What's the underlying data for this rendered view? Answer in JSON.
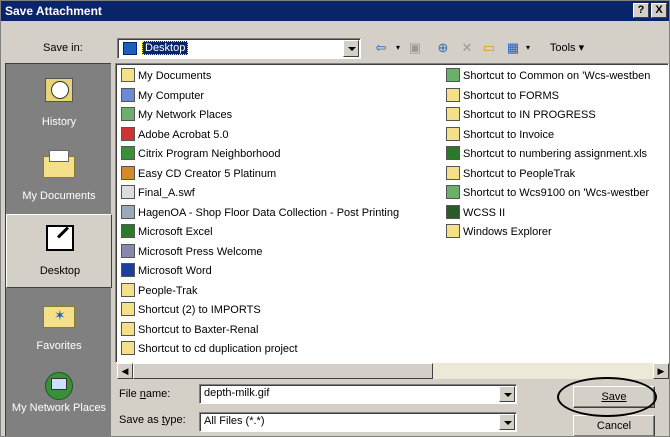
{
  "window": {
    "title": "Save Attachment"
  },
  "titlebar": {
    "help": "?",
    "close": "X"
  },
  "save_in": {
    "label": "Save in:",
    "value": "Desktop"
  },
  "toolbar": {
    "tools_label": "Tools",
    "icons": [
      "back-icon",
      "up-folder-icon",
      "search-web-icon",
      "delete-icon",
      "new-folder-icon",
      "views-icon"
    ]
  },
  "places": [
    {
      "label": "History",
      "icon": "history-icon",
      "active": false
    },
    {
      "label": "My Documents",
      "icon": "my-documents-icon",
      "active": false
    },
    {
      "label": "Desktop",
      "icon": "desktop-icon",
      "active": true
    },
    {
      "label": "Favorites",
      "icon": "favorites-icon",
      "active": false
    },
    {
      "label": "My Network Places",
      "icon": "network-places-icon",
      "active": false
    }
  ],
  "files_col1": [
    "My Documents",
    "My Computer",
    "My Network Places",
    "Adobe Acrobat 5.0",
    "Citrix Program Neighborhood",
    "Easy CD Creator 5 Platinum",
    "Final_A.swf",
    "HagenOA - Shop Floor Data Collection - Post Printing",
    "Microsoft Excel",
    "Microsoft Press Welcome",
    "Microsoft Word",
    "People-Trak",
    "Shortcut (2) to IMPORTS",
    "Shortcut to Baxter-Renal",
    "Shortcut to cd duplication project"
  ],
  "files_col2": [
    "Shortcut to Common on 'Wcs-westben",
    "Shortcut to FORMS",
    "Shortcut to IN PROGRESS",
    "Shortcut to Invoice",
    "Shortcut to numbering assignment.xls",
    "Shortcut to PeopleTrak",
    "Shortcut to Wcs9100 on 'Wcs-westber",
    "WCSS II",
    "Windows Explorer"
  ],
  "file_name": {
    "label": "File name:",
    "value": "depth-milk.gif"
  },
  "save_as_type": {
    "label": "Save as type:",
    "value": "All Files (*.*)"
  },
  "buttons": {
    "save": "Save",
    "cancel": "Cancel"
  },
  "colors": {
    "titlebar": "#0a246a",
    "face": "#d4d0c8",
    "places_bg": "#808080",
    "selection": "#0a246a"
  }
}
